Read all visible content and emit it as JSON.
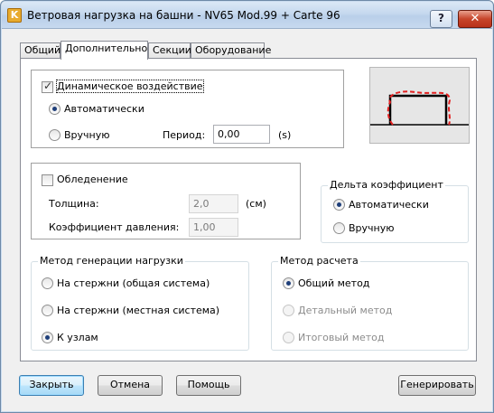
{
  "window": {
    "title": "Ветровая нагрузка на башни - NV65 Mod.99 + Carte 96",
    "app_icon_letter": "K",
    "help_symbol": "?",
    "close_symbol": "✕"
  },
  "tabs": [
    {
      "label": "Общий",
      "active": false
    },
    {
      "label": "Дополнительно",
      "active": true
    },
    {
      "label": "Секции",
      "active": false
    },
    {
      "label": "Оборудование",
      "active": false
    }
  ],
  "dynamic": {
    "checkbox_label": "Динамическое воздействие",
    "checked": true,
    "auto_label": "Автоматически",
    "manual_label": "Вручную",
    "selected": "auto",
    "period_label": "Период:",
    "period_value": "0,00",
    "period_unit": "(s)"
  },
  "icing": {
    "checkbox_label": "Обледенение",
    "checked": false,
    "thickness_label": "Толщина:",
    "thickness_value": "2,0",
    "thickness_unit": "(см)",
    "pressure_label": "Коэффициент давления:",
    "pressure_value": "1,00"
  },
  "delta": {
    "legend": "Дельта коэффициент",
    "auto_label": "Автоматически",
    "manual_label": "Вручную",
    "selected": "auto"
  },
  "load_generation": {
    "legend": "Метод генерации нагрузки",
    "options": [
      {
        "label": "На стержни (общая система)",
        "selected": false
      },
      {
        "label": "На стержни (местная система)",
        "selected": false
      },
      {
        "label": "К узлам",
        "selected": true
      }
    ]
  },
  "calc_method": {
    "legend": "Метод расчета",
    "options": [
      {
        "label": "Общий метод",
        "selected": true,
        "enabled": true
      },
      {
        "label": "Детальный метод",
        "selected": false,
        "enabled": false
      },
      {
        "label": "Итоговый метод",
        "selected": false,
        "enabled": false
      }
    ]
  },
  "buttons": {
    "close": "Закрыть",
    "cancel": "Отмена",
    "help": "Помощь",
    "generate": "Генерировать"
  },
  "colors": {
    "preview_bg": "#e6e6e6",
    "structure": "#000000",
    "dynamic_shape": "#e32020"
  }
}
